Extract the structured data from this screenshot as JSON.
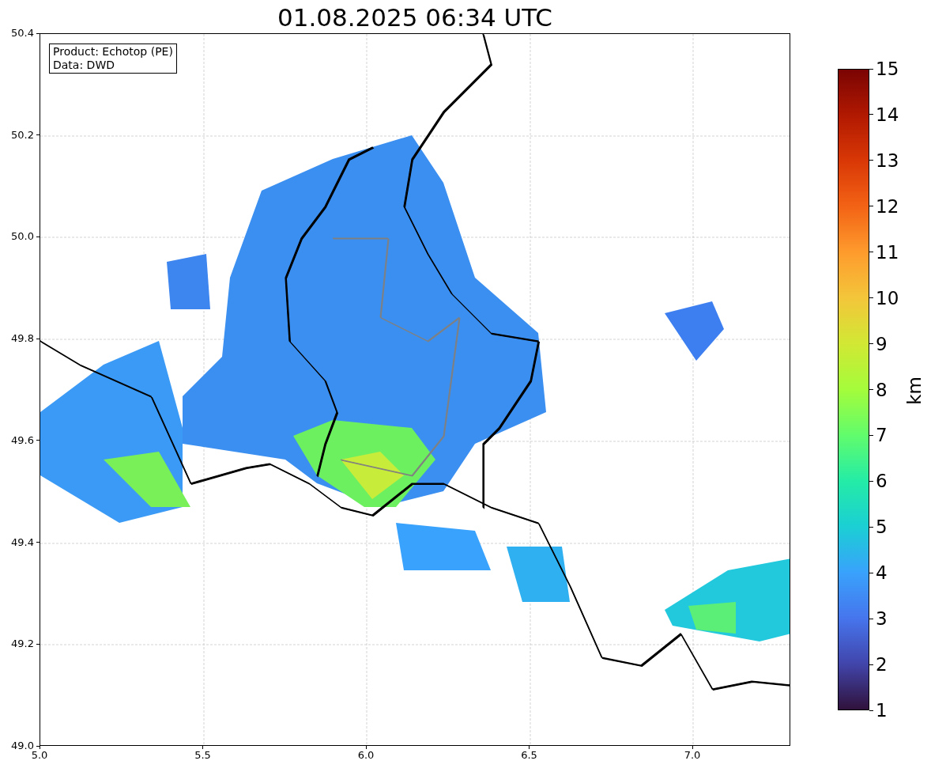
{
  "title": "01.08.2025 06:34 UTC",
  "annotation": [
    "Product: Echotop (PE)",
    "Data: DWD"
  ],
  "x_ticks": [
    "5.0",
    "5.5",
    "6.0",
    "6.5",
    "7.0"
  ],
  "y_ticks": [
    "50.4",
    "50.2",
    "50.0",
    "49.8",
    "49.6",
    "49.4",
    "49.2",
    "49.0"
  ],
  "colorbar": {
    "label": "km",
    "ticks": [
      "15",
      "14",
      "13",
      "12",
      "11",
      "10",
      "9",
      "8",
      "7",
      "6",
      "5",
      "4",
      "3",
      "2",
      "1"
    ]
  }
}
